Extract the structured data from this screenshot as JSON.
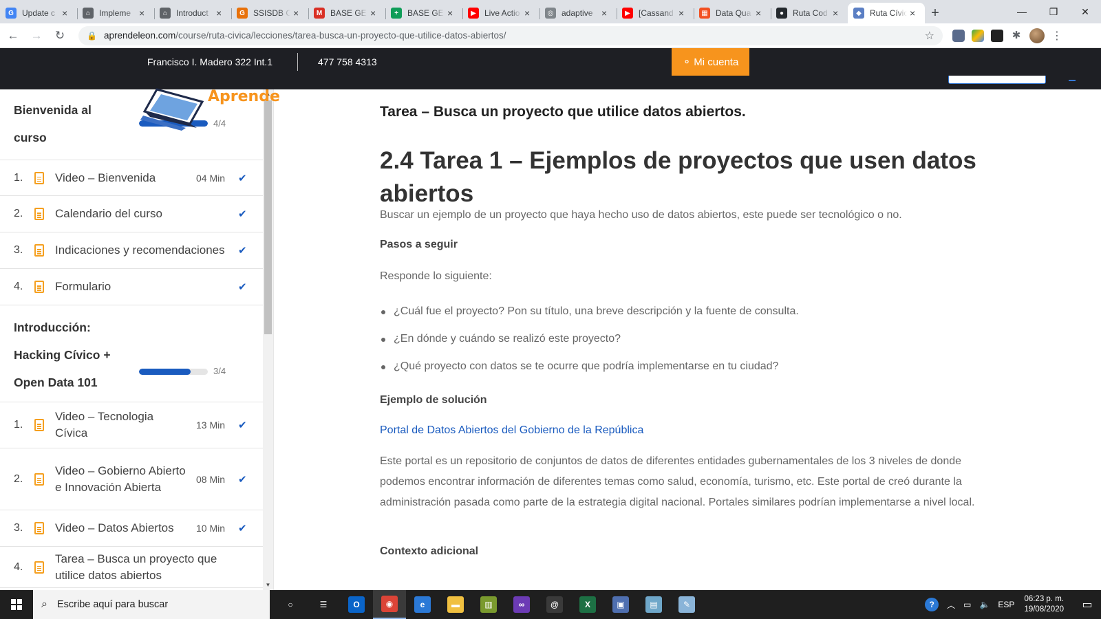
{
  "browser": {
    "tabs": [
      {
        "title": "Update c",
        "favicon": "google-icon",
        "color": "#4285f4",
        "glyph": "G"
      },
      {
        "title": "Impleme",
        "favicon": "home-icon",
        "color": "#5f6368",
        "glyph": "⌂"
      },
      {
        "title": "Introduct",
        "favicon": "home-icon",
        "color": "#5f6368",
        "glyph": "⌂"
      },
      {
        "title": "SSISDB C",
        "favicon": "ssisdb-icon",
        "color": "#e8710a",
        "glyph": "G"
      },
      {
        "title": "BASE GEN",
        "favicon": "gmail-icon",
        "color": "#d93025",
        "glyph": "M"
      },
      {
        "title": "BASE GEN",
        "favicon": "sheets-icon",
        "color": "#0f9d58",
        "glyph": "+"
      },
      {
        "title": "Live Actio",
        "favicon": "youtube-icon",
        "color": "#ff0000",
        "glyph": "▶"
      },
      {
        "title": "adaptive",
        "favicon": "globe-icon",
        "color": "#80868b",
        "glyph": "◎"
      },
      {
        "title": "[Cassand",
        "favicon": "youtube-icon",
        "color": "#ff0000",
        "glyph": "▶"
      },
      {
        "title": "Data Qua",
        "favicon": "microsoft-icon",
        "color": "#f25022",
        "glyph": "▦"
      },
      {
        "title": "Ruta Cod",
        "favicon": "github-icon",
        "color": "#24292e",
        "glyph": "●"
      },
      {
        "title": "Ruta Cívic",
        "favicon": "aprende-icon",
        "color": "#5b7fc4",
        "glyph": "◆"
      }
    ],
    "active_tab": 11,
    "new_tab_glyph": "+",
    "url_host": "aprendeleon.com",
    "url_path": "/course/ruta-civica/lecciones/tarea-busca-un-proyecto-que-utilice-datos-abiertos/"
  },
  "site": {
    "address": "Francisco I. Madero 322 Int.1",
    "phone": "477 758 4313",
    "account_label": "Mi cuenta",
    "logo_word": "Aprende"
  },
  "sidebar": {
    "sections": [
      {
        "title_lines": [
          "Bienvenida al",
          "curso"
        ],
        "progress_text": "4/4",
        "progress": 1.0,
        "lessons": [
          {
            "num": "1.",
            "title": "Video – Bienvenida",
            "duration": "04 Min",
            "done": true
          },
          {
            "num": "2.",
            "title": "Calendario del curso",
            "duration": "",
            "done": true
          },
          {
            "num": "3.",
            "title": "Indicaciones y recomendaciones",
            "duration": "",
            "done": true
          },
          {
            "num": "4.",
            "title": "Formulario",
            "duration": "",
            "done": true
          }
        ]
      },
      {
        "title_lines": [
          "Introducción:",
          "Hacking Cívico +",
          "Open Data 101"
        ],
        "progress_text": "3/4",
        "progress": 0.75,
        "lessons": [
          {
            "num": "1.",
            "title": "Video – Tecnologia Cívica",
            "duration": "13 Min",
            "done": true
          },
          {
            "num": "2.",
            "title": "Video – Gobierno Abierto e Innovación Abierta",
            "duration": "08 Min",
            "done": true
          },
          {
            "num": "3.",
            "title": "Video – Datos Abiertos",
            "duration": "10 Min",
            "done": true
          },
          {
            "num": "4.",
            "title": "Tarea – Busca un proyecto que utilice datos abiertos",
            "duration": "",
            "done": false
          }
        ]
      }
    ]
  },
  "main": {
    "lesson_heading": "Tarea – Busca un proyecto que utilice datos abiertos.",
    "title": "2.4 Tarea 1 – Ejemplos de proyectos que usen datos abiertos",
    "intro": "Buscar un ejemplo de un proyecto que haya hecho uso de datos abiertos, este puede ser tecnológico o no.",
    "steps_heading": "Pasos a seguir",
    "respond": "Responde lo siguiente:",
    "bullets": [
      "¿Cuál fue el proyecto? Pon su título, una breve descripción y la fuente de consulta.",
      "¿En dónde y cuándo se realizó este proyecto?",
      "¿Qué proyecto con datos se te ocurre que podría implementarse en tu ciudad?"
    ],
    "example_heading": "Ejemplo de solución",
    "example_link": "Portal de Datos Abiertos del Gobierno de la República",
    "example_text": "Este portal es un repositorio de conjuntos de datos de diferentes entidades gubernamentales de los 3 niveles de donde podemos encontrar información de diferentes temas como salud, economía, turismo, etc. Este portal de creó durante la administración pasada como parte de la estrategia digital nacional. Portales similares podrían implementarse a nivel local.",
    "context_heading": "Contexto adicional"
  },
  "taskbar": {
    "search_placeholder": "Escribe aquí para buscar",
    "language": "ESP",
    "time": "06:23 p. m.",
    "date": "19/08/2020",
    "apps": [
      {
        "name": "task-view-icon",
        "glyph": "○",
        "color": "transparent"
      },
      {
        "name": "timeline-icon",
        "glyph": "☰",
        "color": "transparent"
      },
      {
        "name": "outlook-icon",
        "glyph": "O",
        "color": "#0a64c8"
      },
      {
        "name": "chrome-icon",
        "glyph": "◉",
        "color": "#db4437"
      },
      {
        "name": "edge-icon",
        "glyph": "e",
        "color": "#2b79d6"
      },
      {
        "name": "file-explorer-icon",
        "glyph": "▬",
        "color": "#f0c040"
      },
      {
        "name": "power-bi-icon",
        "glyph": "▥",
        "color": "#7a9a2e"
      },
      {
        "name": "visual-studio-icon",
        "glyph": "∞",
        "color": "#6c3bb5"
      },
      {
        "name": "mail-client-icon",
        "glyph": "@",
        "color": "#3a3a3a"
      },
      {
        "name": "excel-icon",
        "glyph": "X",
        "color": "#1d7044"
      },
      {
        "name": "rdp-icon",
        "glyph": "▣",
        "color": "#4f6fb0"
      },
      {
        "name": "notepad-icon",
        "glyph": "▤",
        "color": "#6fa7c9"
      },
      {
        "name": "paint-icon",
        "glyph": "✎",
        "color": "#8ab4d8"
      }
    ]
  },
  "colors": {
    "accent_orange": "#f7941d",
    "accent_blue": "#1a5bbf",
    "site_dark": "#1e1f24"
  }
}
